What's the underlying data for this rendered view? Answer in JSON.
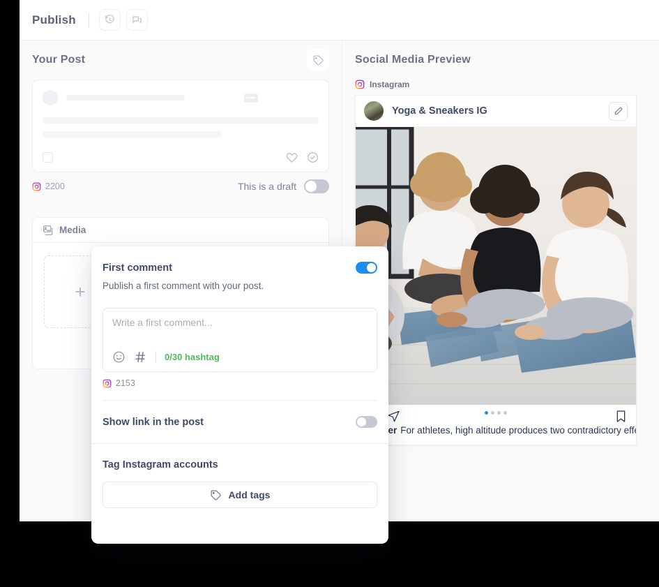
{
  "topbar": {
    "title": "Publish",
    "history_icon": "history-icon",
    "comments_icon": "comments-icon"
  },
  "left_panel": {
    "title": "Your Post",
    "tag_icon": "tag-icon",
    "composer": {
      "char_count": "2200",
      "instagram_icon": "instagram-icon",
      "heart_icon": "heart-icon",
      "check_circle_icon": "check-circle-icon",
      "draft_label": "This is a draft",
      "draft_toggle_on": false
    },
    "media": {
      "tab_label": "Media",
      "media_icon": "images-icon",
      "add_label": "+"
    }
  },
  "right_panel": {
    "title": "Social Media Preview",
    "network": {
      "name": "Instagram",
      "icon": "instagram-icon"
    },
    "post": {
      "account_name": "Yoga & Sneakers IG",
      "avatar": "avatar",
      "edit_icon": "pencil-icon",
      "comment_icon": "comment-icon",
      "share_icon": "share-icon",
      "bookmark_icon": "bookmark-icon",
      "carousel_dots": 4,
      "carousel_active": 0,
      "caption_username": "Cooper",
      "caption_text": "For athletes, high altitude produces two contradictory effects on performance. For explosive events (sprints up to 400 metres, long jump, triple jump) the reduction in atmospheric pressure means there is less resistance from the atmosphere and the athlete's performance will generally be better at high altitude."
    }
  },
  "modal": {
    "first_comment": {
      "title": "First comment",
      "description": "Publish a first comment with your post.",
      "toggle_on": true,
      "placeholder": "Write a first comment...",
      "emoji_icon": "emoji-icon",
      "hashtag_icon": "hashtag-icon",
      "hashtag_count": "0/30 hashtag",
      "char_count": "2153",
      "instagram_icon": "instagram-icon"
    },
    "show_link": {
      "title": "Show link in the post",
      "toggle_on": false
    },
    "tag_accounts": {
      "title": "Tag Instagram accounts",
      "add_tags_label": "Add tags",
      "tag_icon": "tag-icon"
    }
  },
  "colors": {
    "toggle_on": "#1f8cf0",
    "toggle_off": "#c3c8d3",
    "hashtag_green": "#4cbb5a",
    "title_gray": "#6b7285",
    "text_dark": "#3e4a66"
  }
}
